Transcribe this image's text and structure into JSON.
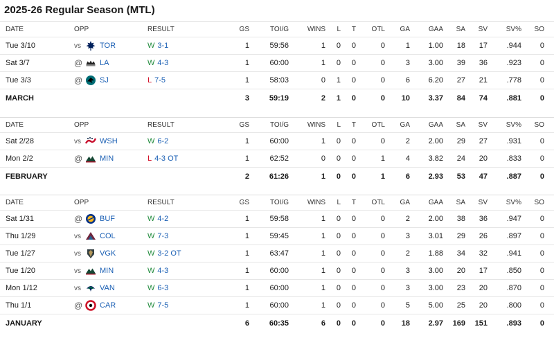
{
  "page": {
    "title": "2025-26 Regular Season (MTL)"
  },
  "colors": {
    "link": "#1a5fb4",
    "win": "#1f8a3b",
    "loss": "#d0021b"
  },
  "headers": [
    "DATE",
    "OPP",
    "RESULT",
    "GS",
    "TOI/G",
    "WINS",
    "L",
    "T",
    "OTL",
    "GA",
    "GAA",
    "SA",
    "SV",
    "SV%",
    "SO"
  ],
  "sections": [
    {
      "games": [
        {
          "date": "Tue 3/10",
          "prefix": "vs",
          "logo": "maple-leafs-logo",
          "opp": "TOR",
          "wl": "W",
          "score": "3-1",
          "gs": "1",
          "toi": "59:56",
          "wins": "1",
          "l": "0",
          "t": "0",
          "otl": "0",
          "ga": "1",
          "gaa": "1.00",
          "sa": "18",
          "sv": "17",
          "svp": ".944",
          "so": "0"
        },
        {
          "date": "Sat 3/7",
          "prefix": "@",
          "logo": "kings-logo",
          "opp": "LA",
          "wl": "W",
          "score": "4-3",
          "gs": "1",
          "toi": "60:00",
          "wins": "1",
          "l": "0",
          "t": "0",
          "otl": "0",
          "ga": "3",
          "gaa": "3.00",
          "sa": "39",
          "sv": "36",
          "svp": ".923",
          "so": "0"
        },
        {
          "date": "Tue 3/3",
          "prefix": "@",
          "logo": "sharks-logo",
          "opp": "SJ",
          "wl": "L",
          "score": "7-5",
          "gs": "1",
          "toi": "58:03",
          "wins": "0",
          "l": "1",
          "t": "0",
          "otl": "0",
          "ga": "6",
          "gaa": "6.20",
          "sa": "27",
          "sv": "21",
          "svp": ".778",
          "so": "0"
        }
      ],
      "total": {
        "label": "MARCH",
        "gs": "3",
        "toi": "59:19",
        "wins": "2",
        "l": "1",
        "t": "0",
        "otl": "0",
        "ga": "10",
        "gaa": "3.37",
        "sa": "84",
        "sv": "74",
        "svp": ".881",
        "so": "0"
      }
    },
    {
      "games": [
        {
          "date": "Sat 2/28",
          "prefix": "vs",
          "logo": "capitals-logo",
          "opp": "WSH",
          "wl": "W",
          "score": "6-2",
          "gs": "1",
          "toi": "60:00",
          "wins": "1",
          "l": "0",
          "t": "0",
          "otl": "0",
          "ga": "2",
          "gaa": "2.00",
          "sa": "29",
          "sv": "27",
          "svp": ".931",
          "so": "0"
        },
        {
          "date": "Mon 2/2",
          "prefix": "@",
          "logo": "wild-logo",
          "opp": "MIN",
          "wl": "L",
          "score": "4-3 OT",
          "gs": "1",
          "toi": "62:52",
          "wins": "0",
          "l": "0",
          "t": "0",
          "otl": "1",
          "ga": "4",
          "gaa": "3.82",
          "sa": "24",
          "sv": "20",
          "svp": ".833",
          "so": "0"
        }
      ],
      "total": {
        "label": "FEBRUARY",
        "gs": "2",
        "toi": "61:26",
        "wins": "1",
        "l": "0",
        "t": "0",
        "otl": "1",
        "ga": "6",
        "gaa": "2.93",
        "sa": "53",
        "sv": "47",
        "svp": ".887",
        "so": "0"
      }
    },
    {
      "games": [
        {
          "date": "Sat 1/31",
          "prefix": "@",
          "logo": "sabres-logo",
          "opp": "BUF",
          "wl": "W",
          "score": "4-2",
          "gs": "1",
          "toi": "59:58",
          "wins": "1",
          "l": "0",
          "t": "0",
          "otl": "0",
          "ga": "2",
          "gaa": "2.00",
          "sa": "38",
          "sv": "36",
          "svp": ".947",
          "so": "0"
        },
        {
          "date": "Thu 1/29",
          "prefix": "vs",
          "logo": "avalanche-logo",
          "opp": "COL",
          "wl": "W",
          "score": "7-3",
          "gs": "1",
          "toi": "59:45",
          "wins": "1",
          "l": "0",
          "t": "0",
          "otl": "0",
          "ga": "3",
          "gaa": "3.01",
          "sa": "29",
          "sv": "26",
          "svp": ".897",
          "so": "0"
        },
        {
          "date": "Tue 1/27",
          "prefix": "vs",
          "logo": "golden-knights-logo",
          "opp": "VGK",
          "wl": "W",
          "score": "3-2 OT",
          "gs": "1",
          "toi": "63:47",
          "wins": "1",
          "l": "0",
          "t": "0",
          "otl": "0",
          "ga": "2",
          "gaa": "1.88",
          "sa": "34",
          "sv": "32",
          "svp": ".941",
          "so": "0"
        },
        {
          "date": "Tue 1/20",
          "prefix": "vs",
          "logo": "wild-logo",
          "opp": "MIN",
          "wl": "W",
          "score": "4-3",
          "gs": "1",
          "toi": "60:00",
          "wins": "1",
          "l": "0",
          "t": "0",
          "otl": "0",
          "ga": "3",
          "gaa": "3.00",
          "sa": "20",
          "sv": "17",
          "svp": ".850",
          "so": "0"
        },
        {
          "date": "Mon 1/12",
          "prefix": "vs",
          "logo": "canucks-logo",
          "opp": "VAN",
          "wl": "W",
          "score": "6-3",
          "gs": "1",
          "toi": "60:00",
          "wins": "1",
          "l": "0",
          "t": "0",
          "otl": "0",
          "ga": "3",
          "gaa": "3.00",
          "sa": "23",
          "sv": "20",
          "svp": ".870",
          "so": "0"
        },
        {
          "date": "Thu 1/1",
          "prefix": "@",
          "logo": "hurricanes-logo",
          "opp": "CAR",
          "wl": "W",
          "score": "7-5",
          "gs": "1",
          "toi": "60:00",
          "wins": "1",
          "l": "0",
          "t": "0",
          "otl": "0",
          "ga": "5",
          "gaa": "5.00",
          "sa": "25",
          "sv": "20",
          "svp": ".800",
          "so": "0"
        }
      ],
      "total": {
        "label": "JANUARY",
        "gs": "6",
        "toi": "60:35",
        "wins": "6",
        "l": "0",
        "t": "0",
        "otl": "0",
        "ga": "18",
        "gaa": "2.97",
        "sa": "169",
        "sv": "151",
        "svp": ".893",
        "so": "0"
      }
    }
  ]
}
